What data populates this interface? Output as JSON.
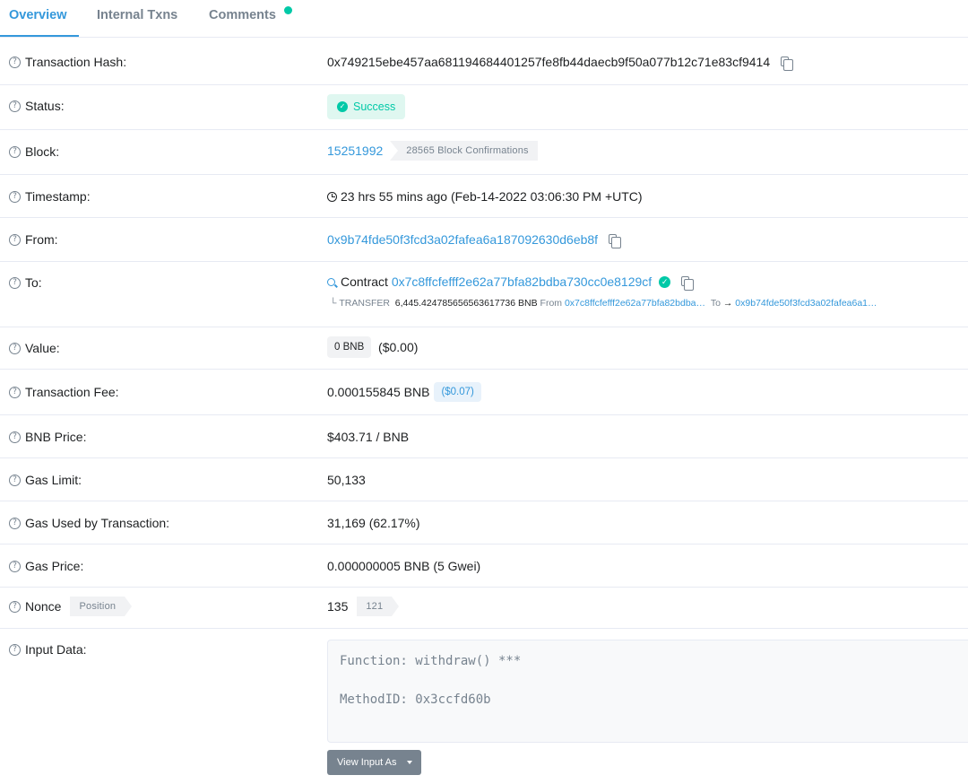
{
  "tabs": [
    {
      "label": "Overview"
    },
    {
      "label": "Internal Txns"
    },
    {
      "label": "Comments"
    }
  ],
  "rows": {
    "hash": {
      "label": "Transaction Hash:",
      "value": "0x749215ebe457aa681194684401257fe8fb44daecb9f50a077b12c71e83cf9414"
    },
    "status": {
      "label": "Status:",
      "value": "Success"
    },
    "block": {
      "label": "Block:",
      "value": "15251992",
      "confirmations": "28565 Block Confirmations"
    },
    "timestamp": {
      "label": "Timestamp:",
      "value": "23 hrs 55 mins ago (Feb-14-2022 03:06:30 PM +UTC)"
    },
    "from": {
      "label": "From:",
      "value": "0x9b74fde50f3fcd3a02fafea6a187092630d6eb8f"
    },
    "to": {
      "label": "To:",
      "prefix": "Contract",
      "value": "0x7c8ffcfefff2e62a77bfa82bdba730cc0e8129cf",
      "transfer": {
        "kind": "TRANSFER",
        "amount": "6,445.424785656563617736 BNB",
        "from_label": "From",
        "from_addr": "0x7c8ffcfefff2e62a77bfa82bdba…",
        "to_label": "To",
        "to_addr": "0x9b74fde50f3fcd3a02fafea6a1…"
      }
    },
    "value": {
      "label": "Value:",
      "amount": "0 BNB",
      "usd": "($0.00)"
    },
    "fee": {
      "label": "Transaction Fee:",
      "value": "0.000155845 BNB",
      "usd": "($0.07)"
    },
    "price": {
      "label": "BNB Price:",
      "value": "$403.71 / BNB"
    },
    "gas_limit": {
      "label": "Gas Limit:",
      "value": "50,133"
    },
    "gas_used": {
      "label": "Gas Used by Transaction:",
      "value": "31,169 (62.17%)"
    },
    "gas_price": {
      "label": "Gas Price:",
      "value": "0.000000005 BNB (5 Gwei)"
    },
    "nonce": {
      "label": "Nonce",
      "position_label": "Position",
      "value": "135",
      "position": "121"
    },
    "input": {
      "label": "Input Data:",
      "function_line": "Function: withdraw() ***",
      "method_line": "MethodID: 0x3ccfd60b",
      "view_button": "View Input As"
    }
  },
  "colors": {
    "accent": "#3498db",
    "success": "#00c9a7",
    "muted": "#77838f"
  }
}
